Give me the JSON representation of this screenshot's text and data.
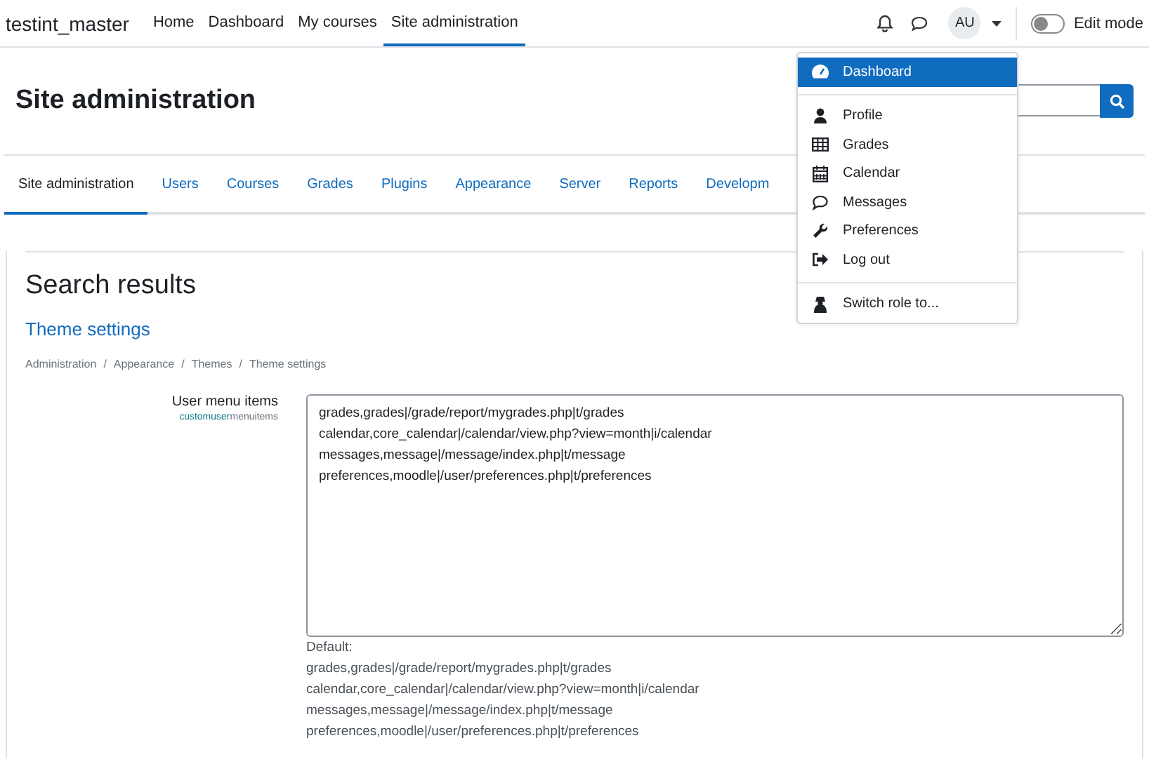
{
  "navbar": {
    "brand": "testint_master",
    "links": [
      {
        "label": "Home",
        "selected": false
      },
      {
        "label": "Dashboard",
        "selected": false
      },
      {
        "label": "My courses",
        "selected": false
      },
      {
        "label": "Site administration",
        "selected": true
      }
    ],
    "avatar": "AU",
    "edit_mode": {
      "label": "Edit mode",
      "on": false
    }
  },
  "user_menu": {
    "groups": [
      [
        {
          "label": "Dashboard",
          "kind": "dashboard",
          "selected": true
        }
      ],
      [
        {
          "label": "Profile",
          "kind": "user",
          "selected": false
        },
        {
          "label": "Grades",
          "kind": "table",
          "selected": false
        },
        {
          "label": "Calendar",
          "kind": "calendar",
          "selected": false
        },
        {
          "label": "Messages",
          "kind": "comment",
          "selected": false
        },
        {
          "label": "Preferences",
          "kind": "wrench",
          "selected": false
        },
        {
          "label": "Log out",
          "kind": "logout",
          "selected": false
        }
      ],
      [
        {
          "label": "Switch role to...",
          "kind": "role",
          "selected": false
        }
      ]
    ]
  },
  "page_title": "Site administration",
  "tabs": [
    {
      "label": "Site administration",
      "selected": true
    },
    {
      "label": "Users",
      "selected": false
    },
    {
      "label": "Courses",
      "selected": false
    },
    {
      "label": "Grades",
      "selected": false
    },
    {
      "label": "Plugins",
      "selected": false
    },
    {
      "label": "Appearance",
      "selected": false
    },
    {
      "label": "Server",
      "selected": false
    },
    {
      "label": "Reports",
      "selected": false
    },
    {
      "label": "Developm",
      "selected": false
    }
  ],
  "heading": "Search results",
  "section_link": "Theme settings",
  "breadcrumb": {
    "separator": "/",
    "items": [
      "Administration",
      "Appearance",
      "Themes",
      "Theme settings"
    ]
  },
  "setting": {
    "label": "User menu items",
    "id_highlight": "customuser",
    "id_rest": "menuitems",
    "value": [
      "grades,grades|/grade/report/mygrades.php|t/grades",
      "calendar,core_calendar|/calendar/view.php?view=month|i/calendar",
      "messages,message|/message/index.php|t/message",
      "preferences,moodle|/user/preferences.php|t/preferences"
    ],
    "default_label": "Default:",
    "default": [
      "grades,grades|/grade/report/mygrades.php|t/grades",
      "calendar,core_calendar|/calendar/view.php?view=month|i/calendar",
      "messages,message|/message/index.php|t/message",
      "preferences,moodle|/user/preferences.php|t/preferences"
    ]
  }
}
